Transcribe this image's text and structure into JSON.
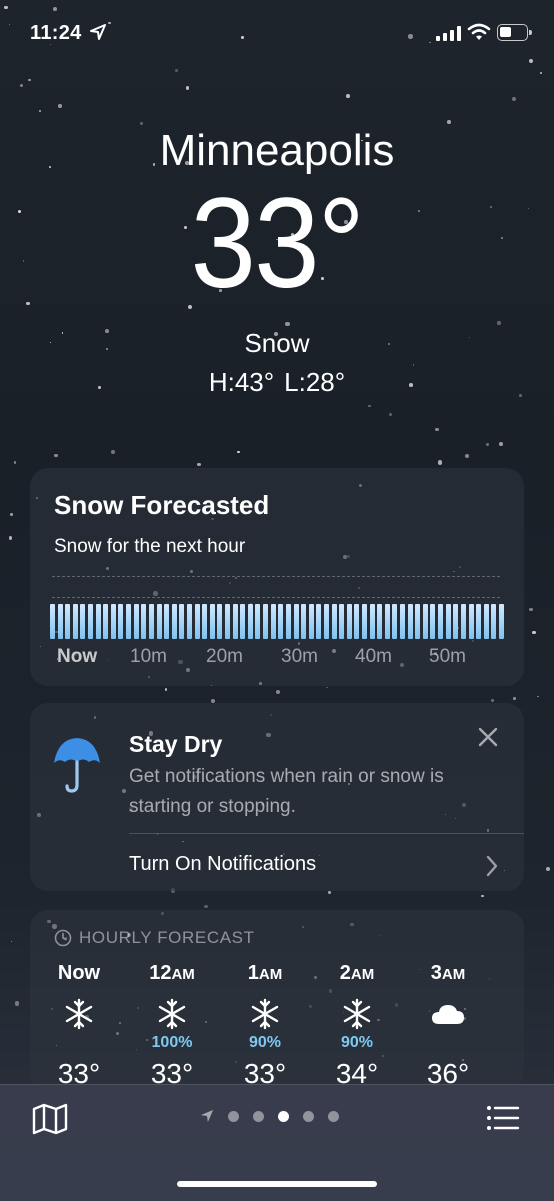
{
  "status": {
    "time": "11:24"
  },
  "hero": {
    "city": "Minneapolis",
    "temp": "33°",
    "condition": "Snow",
    "high": "H:43°",
    "low": "L:28°"
  },
  "nowcast": {
    "title": "Snow Forecasted",
    "subtitle": "Snow for the next hour",
    "ticks": [
      "Now",
      "10m",
      "20m",
      "30m",
      "40m",
      "50m"
    ],
    "bar_count": 60,
    "bar_color": "#a9d8f8"
  },
  "notify": {
    "title": "Stay Dry",
    "description": "Get notifications when rain or snow is starting or stopping.",
    "link": "Turn On Notifications",
    "icons": [
      "umbrella-icon",
      "close-icon",
      "chevron-right-icon"
    ],
    "accent": "#3d8fe6"
  },
  "hourly": {
    "header": "HOURLY FORECAST",
    "items": [
      {
        "hour": "Now",
        "suffix": "",
        "icon": "snowflake-icon",
        "precip": "",
        "temp": "33°"
      },
      {
        "hour": "12",
        "suffix": "AM",
        "icon": "snowflake-icon",
        "precip": "100%",
        "temp": "33°"
      },
      {
        "hour": "1",
        "suffix": "AM",
        "icon": "snowflake-icon",
        "precip": "90%",
        "temp": "33°"
      },
      {
        "hour": "2",
        "suffix": "AM",
        "icon": "snowflake-icon",
        "precip": "90%",
        "temp": "34°"
      },
      {
        "hour": "3",
        "suffix": "AM",
        "icon": "cloud-icon",
        "precip": "",
        "temp": "36°"
      }
    ],
    "precip_color": "#7dc9f2"
  },
  "tabbar": {
    "icons": [
      "map-icon",
      "location-arrow-icon",
      "list-icon"
    ],
    "page_count": 5,
    "active_page": 3
  }
}
